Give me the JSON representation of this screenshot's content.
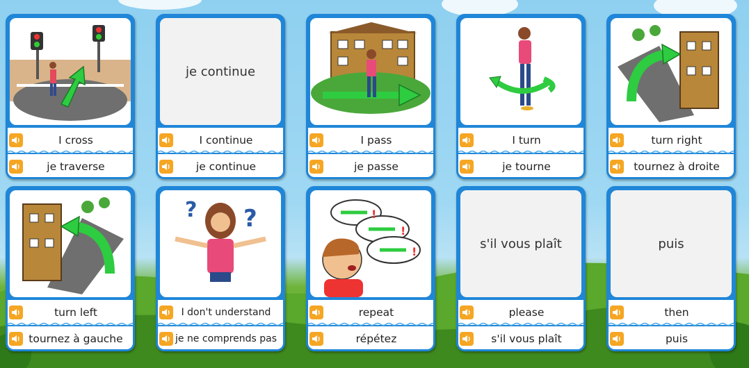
{
  "cards": [
    {
      "prompt": "",
      "english": "I cross",
      "french": "je traverse",
      "picture": "crossing-road-picture"
    },
    {
      "prompt": "je continue",
      "english": "I continue",
      "french": "je continue",
      "picture": ""
    },
    {
      "prompt": "",
      "english": "I pass",
      "french": "je passe",
      "picture": "passing-building-picture"
    },
    {
      "prompt": "",
      "english": "I turn",
      "french": "je tourne",
      "picture": "turning-person-picture"
    },
    {
      "prompt": "",
      "english": "turn right",
      "french": "tournez à droite",
      "picture": "turn-right-street-picture"
    },
    {
      "prompt": "",
      "english": "turn left",
      "french": "tournez à gauche",
      "picture": "turn-left-street-picture"
    },
    {
      "prompt": "",
      "english": "I don't understand",
      "french": "je ne comprends pas",
      "picture": "confused-person-picture"
    },
    {
      "prompt": "",
      "english": "repeat",
      "french": "répétez",
      "picture": "repeat-speech-picture"
    },
    {
      "prompt": "s'il vous plaît",
      "english": "please",
      "french": "s'il vous plaît",
      "picture": ""
    },
    {
      "prompt": "puis",
      "english": "then",
      "french": "puis",
      "picture": ""
    }
  ],
  "colors": {
    "card_border": "#1f86d8",
    "speaker": "#f5a623",
    "arrow": "#2ecc40"
  }
}
